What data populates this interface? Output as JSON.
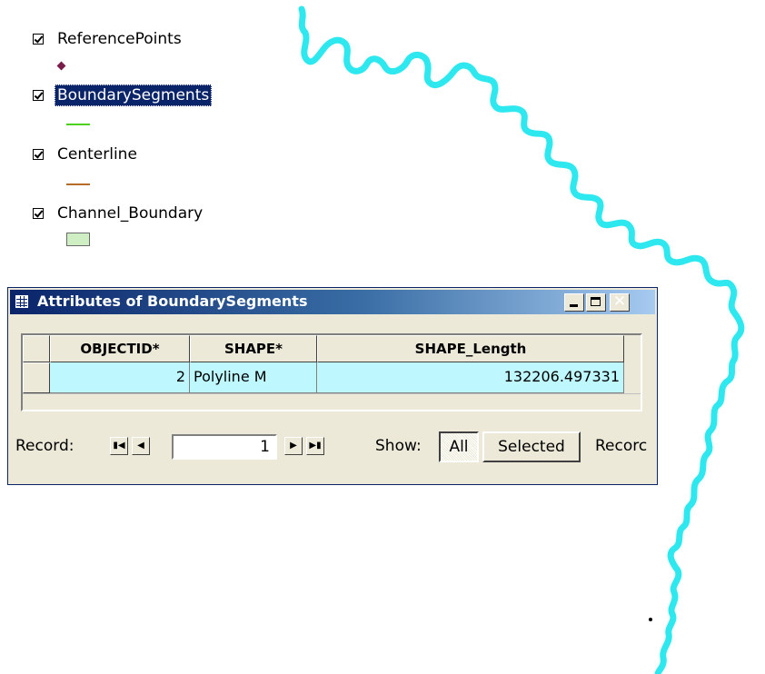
{
  "toc": {
    "layers": [
      {
        "name": "ReferencePoints",
        "checked": true,
        "selected": false
      },
      {
        "name": "BoundarySegments",
        "checked": true,
        "selected": true
      },
      {
        "name": "Centerline",
        "checked": true,
        "selected": false
      },
      {
        "name": "Channel_Boundary",
        "checked": true,
        "selected": false
      }
    ]
  },
  "colors": {
    "river": "#2ee8f0",
    "selection_highlight": "#0a246a",
    "row_highlight": "#bff7ff",
    "boundary_symbol": "#4cd11a",
    "centerline_symbol": "#b76d2a",
    "channel_fill": "#cfeec4",
    "reference_point": "#7a1d4a"
  },
  "attribute_window": {
    "title": "Attributes of BoundarySegments",
    "icon": "table-icon",
    "buttons": {
      "minimize": "minimize-icon",
      "maximize": "maximize-icon",
      "close": "✕"
    },
    "columns": [
      "OBJECTID*",
      "SHAPE*",
      "SHAPE_Length"
    ],
    "rows": [
      {
        "objectid": "2",
        "shape": "Polyline M",
        "shape_length": "132206.497331"
      }
    ],
    "footer": {
      "record_label": "Record:",
      "record_value": "1",
      "show_label": "Show:",
      "all_label": "All",
      "selected_label": "Selected",
      "records_label": "Recorc"
    }
  }
}
